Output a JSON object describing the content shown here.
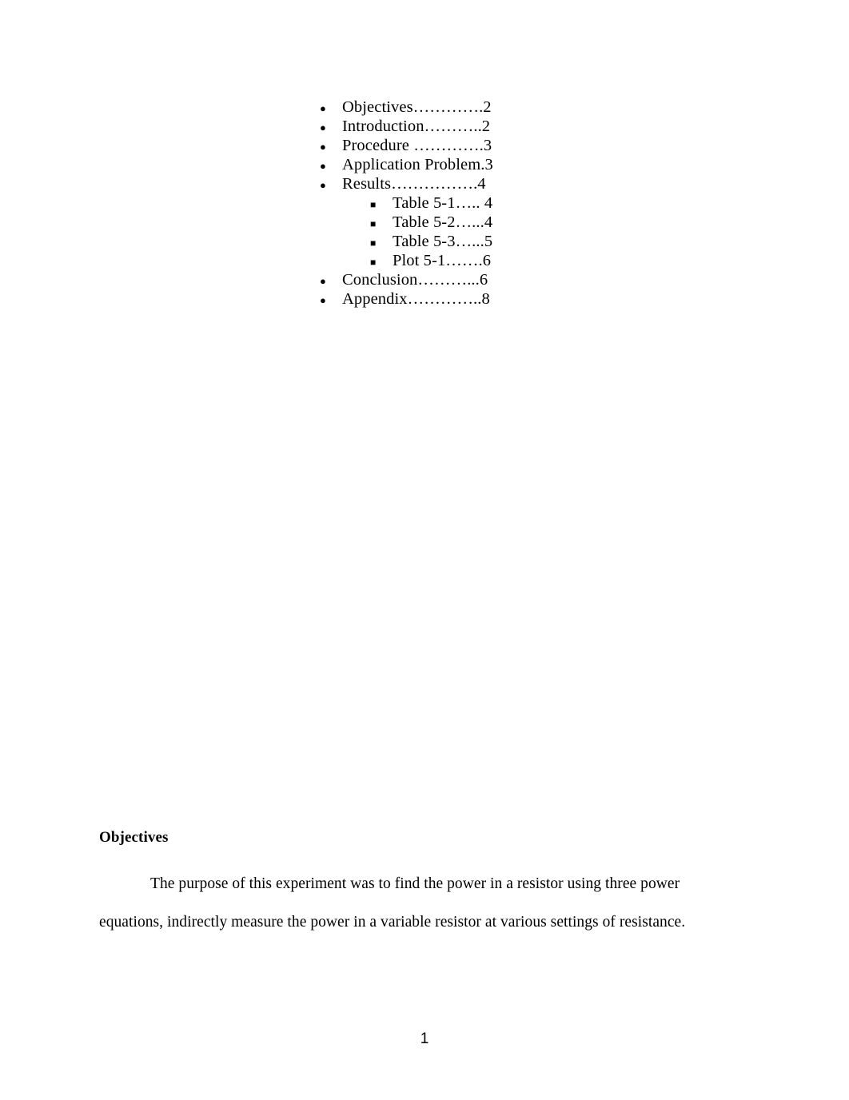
{
  "document": {
    "page_number": "1"
  },
  "toc": {
    "items": [
      {
        "bullet": "disc-bullet",
        "level": 1,
        "text": "Objectives………….2"
      },
      {
        "bullet": "disc-bullet",
        "level": 1,
        "text": "Introduction………..2"
      },
      {
        "bullet": "disc-bullet",
        "level": 1,
        "text": "Procedure ………….3"
      },
      {
        "bullet": "disc-bullet",
        "level": 1,
        "text": "Application Problem.3"
      },
      {
        "bullet": "disc-bullet",
        "level": 1,
        "text": "Results…………….4"
      },
      {
        "bullet": "square-bullet",
        "level": 2,
        "text": "Table 5-1….. 4"
      },
      {
        "bullet": "square-bullet",
        "level": 2,
        "text": "Table 5-2…...4"
      },
      {
        "bullet": "square-bullet",
        "level": 2,
        "text": "Table 5-3…...5"
      },
      {
        "bullet": "square-bullet",
        "level": 2,
        "text": "Plot 5-1…….6"
      },
      {
        "bullet": "disc-bullet",
        "level": 1,
        "text": "Conclusion………...6"
      },
      {
        "bullet": "disc-bullet",
        "level": 1,
        "text": "Appendix…………..8"
      }
    ],
    "glyphs": {
      "disc-bullet": "●",
      "square-bullet": "■"
    }
  },
  "objectives_section": {
    "heading": "Objectives",
    "paragraph": "The purpose of this experiment was to find the power in a resistor using three power equations, indirectly measure the power in a variable resistor at various settings of resistance."
  }
}
